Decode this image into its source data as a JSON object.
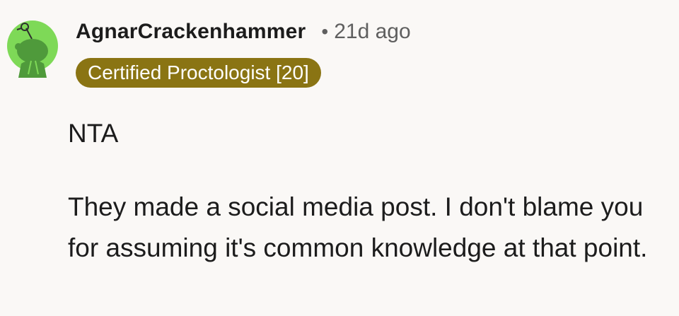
{
  "comment": {
    "username": "AgnarCrackenhammer",
    "separator": "•",
    "timestamp": "21d ago",
    "flair": "Certified Proctologist [20]",
    "paragraphs": [
      "NTA",
      "They made a social media post. I don't blame you for assuming it's common knowledge at that point."
    ]
  },
  "avatar": {
    "icon": "snoo-avatar-icon",
    "background_color": "#7ed957",
    "figure_color": "#4f9a3b"
  },
  "colors": {
    "page_background": "#faf8f6",
    "flair_background": "#8a7413",
    "flair_text": "#ffffff",
    "username_text": "#1c1c1c",
    "meta_text": "#5f5f5f"
  }
}
